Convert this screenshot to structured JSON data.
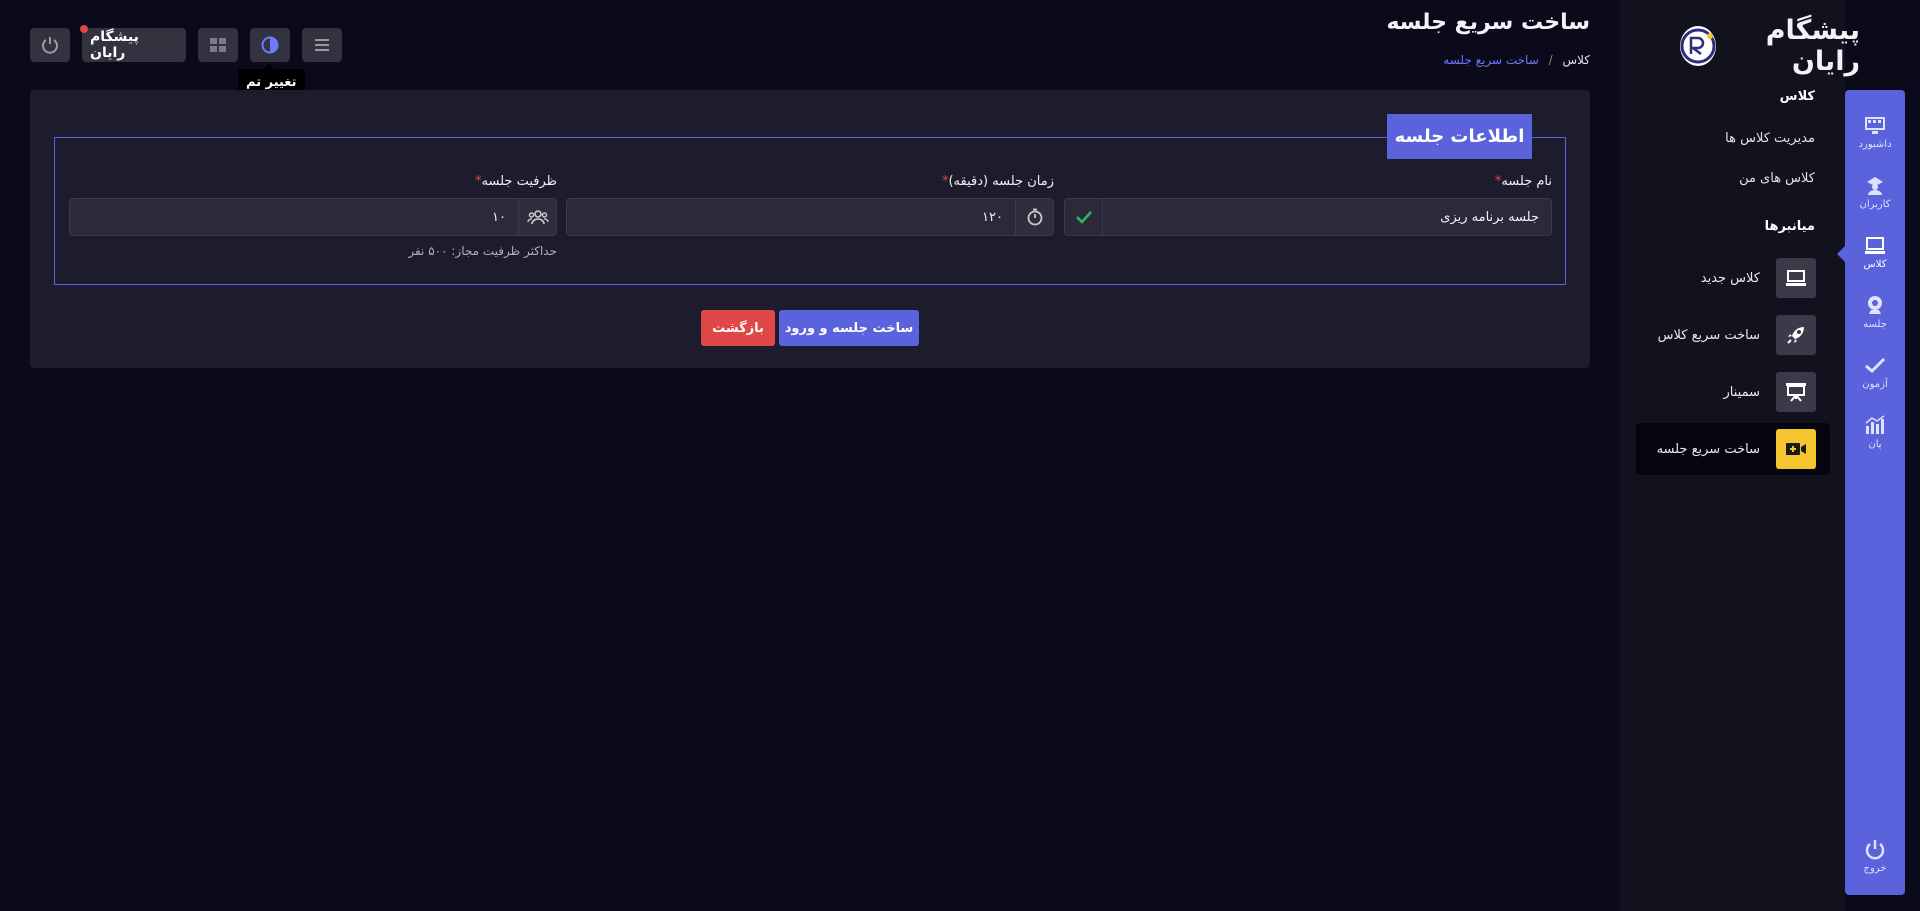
{
  "app": {
    "logo_text": "پیشگام رایان",
    "brand_button": "پیشگام رایان"
  },
  "colors": {
    "accent": "#5a62dc",
    "danger": "#e04848",
    "highlight": "#f5c530",
    "background": "#0a0a1a"
  },
  "header": {
    "title": "ساخت سریع جلسه",
    "breadcrumb_root": "کلاس",
    "breadcrumb_separator": "/",
    "breadcrumb_current": "ساخت سریع جلسه",
    "theme_tooltip": "تغییر تم"
  },
  "toolbar": {
    "icons": [
      "power-icon",
      "grid-icon",
      "theme-icon",
      "menu-icon"
    ]
  },
  "rail": {
    "items": [
      {
        "label": "داشبورد",
        "icon": "dashboard-icon"
      },
      {
        "label": "کاربران",
        "icon": "users-icon"
      },
      {
        "label": "کلاس",
        "icon": "class-icon"
      },
      {
        "label": "جلسه",
        "icon": "session-icon"
      },
      {
        "label": "آزمون",
        "icon": "check-icon"
      },
      {
        "label": "پان",
        "icon": "chart-icon"
      }
    ],
    "active": "کلاس",
    "logout": "خروج"
  },
  "submenu": {
    "section_class": "کلاس",
    "link_manage": "مدیریت کلاس ها",
    "link_mine": "کلاس های من",
    "section_shortcuts": "میانبرها",
    "shortcuts": [
      {
        "label": "کلاس جدید",
        "icon": "monitor-icon"
      },
      {
        "label": "ساخت سریع کلاس",
        "icon": "rocket-icon"
      },
      {
        "label": "سمینار",
        "icon": "presentation-icon"
      },
      {
        "label": "ساخت سریع جلسه",
        "icon": "video-add-icon"
      }
    ],
    "active": "ساخت سریع جلسه"
  },
  "form": {
    "legend": "اطلاعات جلسه",
    "name_label": "نام جلسه",
    "name_value": "جلسه برنامه ریزی",
    "duration_label": "زمان جلسه (دقیقه)",
    "duration_value": "۱۲۰",
    "capacity_label": "ظرفیت جلسه",
    "capacity_value": "۱۰",
    "capacity_hint": "حداکثر ظرفیت مجاز: ۵۰۰ نفر",
    "required_mark": "*",
    "submit_label": "ساخت جلسه و ورود",
    "back_label": "بازگشت"
  }
}
